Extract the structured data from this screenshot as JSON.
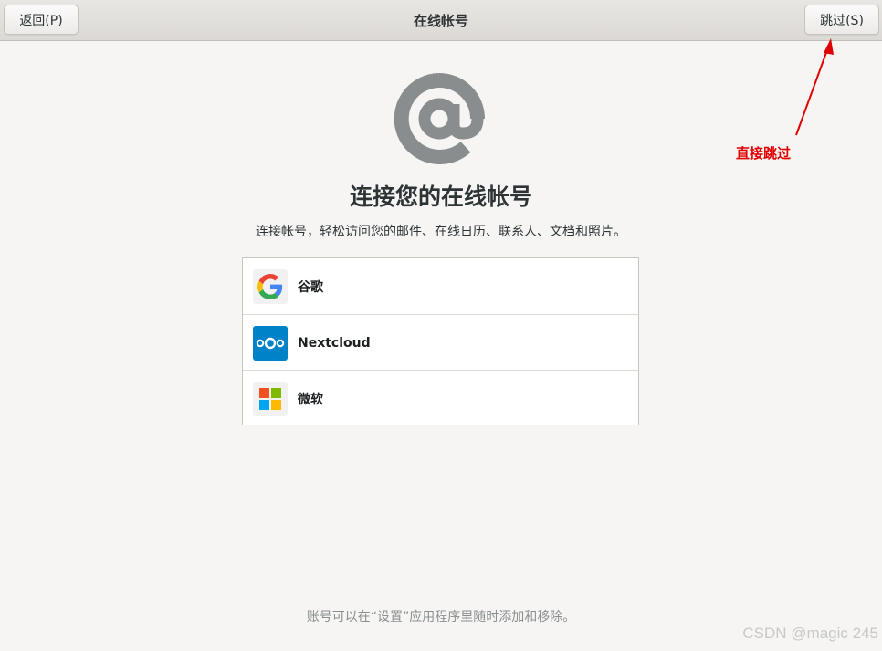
{
  "header": {
    "back_label": "返回(P)",
    "title": "在线帐号",
    "skip_label": "跳过(S)"
  },
  "main": {
    "icon": "at-sign-icon",
    "title": "连接您的在线帐号",
    "subtitle": "连接帐号，轻松访问您的邮件、在线日历、联系人、文档和照片。",
    "providers": [
      {
        "label": "谷歌",
        "icon": "google-icon"
      },
      {
        "label": "Nextcloud",
        "icon": "nextcloud-icon"
      },
      {
        "label": "微软",
        "icon": "microsoft-icon"
      }
    ]
  },
  "footer": {
    "note": "账号可以在“设置”应用程序里随时添加和移除。"
  },
  "annotation": {
    "text": "直接跳过",
    "color": "#e00000"
  },
  "watermark": "CSDN @magic 245"
}
